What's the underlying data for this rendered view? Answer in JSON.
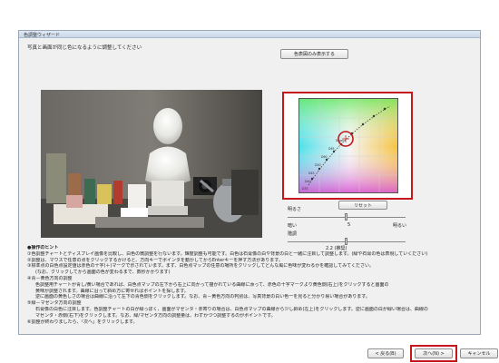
{
  "window": {
    "title": "色調整ウィザード"
  },
  "instruction": "写真と画面が同じ色になるように調整してください",
  "buttons": {
    "show_color_chart_only": "色表図のみ表示する",
    "reset": "リセット",
    "back": "< 戻る(B)",
    "next": "次へ(N) >",
    "cancel": "キャンセル"
  },
  "chart_labels": [
    "Dnom",
    "D65",
    "D60",
    "D50",
    "D45",
    "D40",
    "D35"
  ],
  "brightness": {
    "label": "明るさ",
    "left": "暗い",
    "value": "5",
    "right": "明るい",
    "fraction": 0.5
  },
  "gradation": {
    "label": "階調",
    "value": "2.2 (推奨)",
    "fraction": 0.5
  },
  "hints": {
    "heading": "●操作のヒント",
    "lines": [
      "①色調整チャートとディスプレイ画像を比較し、白色の微調整を行ないます。輝度調整も可能です。白色は石膏像の白や背景の白と一緒に注目して調整します。(緑や石膏の色は表現していください)",
      "②調整は、マウスで任意の点をクリックするかけると、方向キーでポインタを動かしてからEnterキーを押す方法があります。",
      "③標準点の白色点設定値は赤色の十字(＋)マークで示されています。まず、白色点マップの任意の場所をクリックしてどんな風に色味が変わるかを確認してみてください。",
      "(なお、クリックしてから画面の色が変わるまで、数秒かかります)",
      "④青－黄色方向の調整",
      "色調整用チャートが青し/黄い場合であれば、白色点マップの左下から右上に向かって描かれている曲線に添って、赤色の十字マークより黄色側(右上)をクリックすると画面の",
      "黄味が調整されます。曲線に沿って斜め方に寄せればポイントを探します。",
      "逆に画面の黄色しさの場合は曲線に沿って左下の青色側をクリックします。なお、青－黄色方向の判別は、写真背景の白い色一を見ると分かり易い場合があります。",
      "⑤緑－マゼンタ方向の調整",
      "石膏像の白色に注目します。色調整チャートの白が緑っぽく、画面がマゼンタ・赤寄りの場合は、白色点マップの曲線から少し斜め(左上)をクリックします。逆に画面の白が緑い場合は、曲線の",
      "マゼンタ・赤側(右下)をクリックします。なお、緑/マゼンタ方向の調整量は、わずかづつ調整するのがポイントです。",
      "⑥調整が終わりましたら、「次へ」をクリックします。"
    ]
  },
  "colors": {
    "highlight": "#c4161c",
    "window_bg": "#f0f0f0",
    "photo_bg": "#5b5a57"
  }
}
